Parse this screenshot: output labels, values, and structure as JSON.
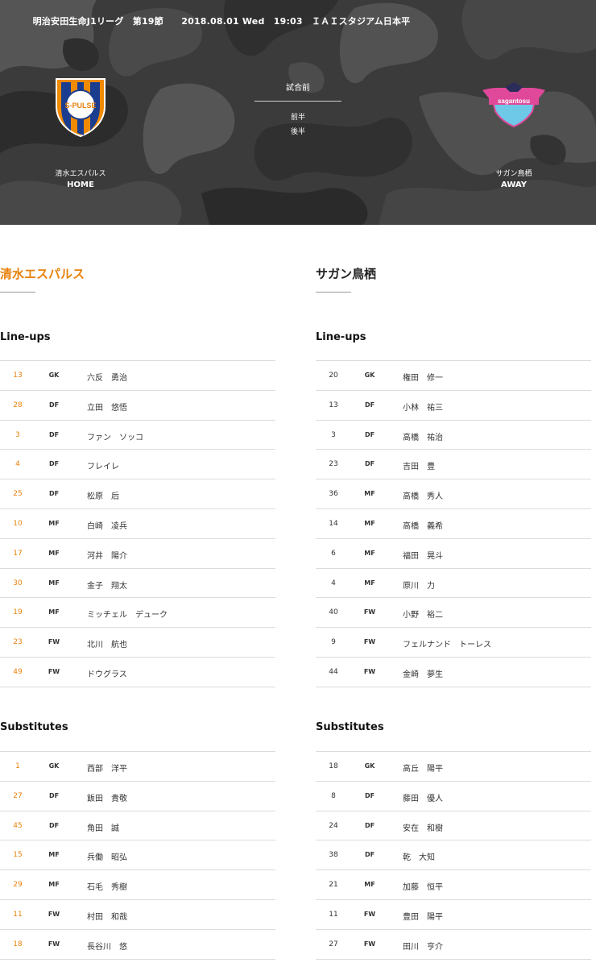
{
  "header": {
    "match_info": "明治安田生命J1リーグ　第19節　　2018.08.01 Wed　19:03　ＩＡＩスタジアム日本平",
    "status": "試合前",
    "first_half": "前半",
    "second_half": "後半",
    "home": {
      "name": "清水エスパルス",
      "side": "HOME",
      "emblem_icon": "s-pulse-emblem-icon",
      "emblem_text": "S-PULSE"
    },
    "away": {
      "name": "サガン鳥栖",
      "side": "AWAY",
      "emblem_icon": "sagan-tosu-emblem-icon",
      "emblem_text": "sagantosu"
    }
  },
  "colors": {
    "accent": "#e8820c",
    "header_bg": "#3d3d3d",
    "divider": "#dcdcdc"
  },
  "home_team": {
    "title": "清水エスパルス",
    "lineups_label": "Line-ups",
    "subs_label": "Substitutes",
    "lineups": [
      {
        "number": "13",
        "position": "GK",
        "name": "六反　勇治"
      },
      {
        "number": "28",
        "position": "DF",
        "name": "立田　悠悟"
      },
      {
        "number": "3",
        "position": "DF",
        "name": "ファン　ソッコ"
      },
      {
        "number": "4",
        "position": "DF",
        "name": "フレイレ"
      },
      {
        "number": "25",
        "position": "DF",
        "name": "松原　后"
      },
      {
        "number": "10",
        "position": "MF",
        "name": "白崎　凌兵"
      },
      {
        "number": "17",
        "position": "MF",
        "name": "河井　陽介"
      },
      {
        "number": "30",
        "position": "MF",
        "name": "金子　翔太"
      },
      {
        "number": "19",
        "position": "MF",
        "name": "ミッチェル　デューク"
      },
      {
        "number": "23",
        "position": "FW",
        "name": "北川　航也"
      },
      {
        "number": "49",
        "position": "FW",
        "name": "ドウグラス"
      }
    ],
    "substitutes": [
      {
        "number": "1",
        "position": "GK",
        "name": "西部　洋平"
      },
      {
        "number": "27",
        "position": "DF",
        "name": "飯田　貴敬"
      },
      {
        "number": "45",
        "position": "DF",
        "name": "角田　誠"
      },
      {
        "number": "15",
        "position": "MF",
        "name": "兵働　昭弘"
      },
      {
        "number": "29",
        "position": "MF",
        "name": "石毛　秀樹"
      },
      {
        "number": "11",
        "position": "FW",
        "name": "村田　和哉"
      },
      {
        "number": "18",
        "position": "FW",
        "name": "長谷川　悠"
      }
    ]
  },
  "away_team": {
    "title": "サガン鳥栖",
    "lineups_label": "Line-ups",
    "subs_label": "Substitutes",
    "lineups": [
      {
        "number": "20",
        "position": "GK",
        "name": "権田　修一"
      },
      {
        "number": "13",
        "position": "DF",
        "name": "小林　祐三"
      },
      {
        "number": "3",
        "position": "DF",
        "name": "高橋　祐治"
      },
      {
        "number": "23",
        "position": "DF",
        "name": "吉田　豊"
      },
      {
        "number": "36",
        "position": "MF",
        "name": "高橋　秀人"
      },
      {
        "number": "14",
        "position": "MF",
        "name": "高橋　義希"
      },
      {
        "number": "6",
        "position": "MF",
        "name": "福田　晃斗"
      },
      {
        "number": "4",
        "position": "MF",
        "name": "原川　力"
      },
      {
        "number": "40",
        "position": "FW",
        "name": "小野　裕二"
      },
      {
        "number": "9",
        "position": "FW",
        "name": "フェルナンド　トーレス"
      },
      {
        "number": "44",
        "position": "FW",
        "name": "金崎　夢生"
      }
    ],
    "substitutes": [
      {
        "number": "18",
        "position": "GK",
        "name": "高丘　陽平"
      },
      {
        "number": "8",
        "position": "DF",
        "name": "藤田　優人"
      },
      {
        "number": "24",
        "position": "DF",
        "name": "安在　和樹"
      },
      {
        "number": "38",
        "position": "DF",
        "name": "乾　大知"
      },
      {
        "number": "21",
        "position": "MF",
        "name": "加藤　恒平"
      },
      {
        "number": "11",
        "position": "FW",
        "name": "豊田　陽平"
      },
      {
        "number": "27",
        "position": "FW",
        "name": "田川　亨介"
      }
    ]
  }
}
